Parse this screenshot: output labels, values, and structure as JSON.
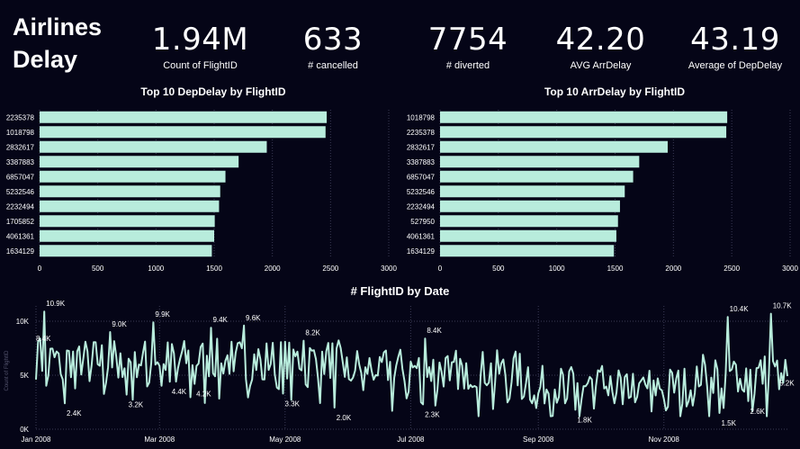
{
  "dashboard": {
    "title_line1": "Airlines",
    "title_line2": "Delay"
  },
  "kpis": [
    {
      "value": "1.94M",
      "label": "Count of FlightID"
    },
    {
      "value": "633",
      "label": "# cancelled"
    },
    {
      "value": "7754",
      "label": "# diverted"
    },
    {
      "value": "42.20",
      "label": "AVG ArrDelay"
    },
    {
      "value": "43.19",
      "label": "Average of DepDelay"
    }
  ],
  "colors": {
    "background": "#050517",
    "bar": "#b8ecdc",
    "line": "#b8ecdc",
    "grid": "#3a3a55"
  },
  "chart_data": [
    {
      "type": "bar",
      "orientation": "horizontal",
      "title": "Top 10 DepDelay by FlightID",
      "categories": [
        "2235378",
        "1018798",
        "2832617",
        "3387883",
        "6857047",
        "5232546",
        "2232494",
        "1705852",
        "4061361",
        "1634129"
      ],
      "values": [
        2467,
        2457,
        1952,
        1710,
        1597,
        1552,
        1542,
        1505,
        1500,
        1480
      ],
      "xlim": [
        0,
        3000
      ],
      "xticks": [
        "0",
        "500",
        "1000",
        "1500",
        "2000",
        "2500",
        "3000"
      ],
      "grid": true
    },
    {
      "type": "bar",
      "orientation": "horizontal",
      "title": "Top 10 ArrDelay by FlightID",
      "categories": [
        "1018798",
        "2235378",
        "2832617",
        "3387883",
        "6857047",
        "5232546",
        "2232494",
        "527950",
        "4061361",
        "1634129"
      ],
      "values": [
        2461,
        2453,
        1951,
        1707,
        1655,
        1583,
        1542,
        1525,
        1511,
        1490
      ],
      "xlim": [
        0,
        3000
      ],
      "xticks": [
        "0",
        "500",
        "1000",
        "1500",
        "2000",
        "2500",
        "3000"
      ],
      "grid": true
    },
    {
      "type": "line",
      "title": "# FlightID by Date",
      "ylabel": "Count of FlightID",
      "ylim": [
        0,
        11000
      ],
      "yticks": [
        "0K",
        "5K",
        "10K"
      ],
      "xticks": [
        "Jan 2008",
        "Mar 2008",
        "May 2008",
        "Jul 2008",
        "Sep 2008",
        "Nov 2008"
      ],
      "annotations": [
        "10.9K",
        "8.4K",
        "2.4K",
        "9.0K",
        "3.2K",
        "9.9K",
        "4.4K",
        "4.2K",
        "9.4K",
        "9.6K",
        "3.3K",
        "8.2K",
        "2.0K",
        "8.4K",
        "2.3K",
        "1.8K",
        "1.5K",
        "10.4K",
        "2.6K",
        "10.7K",
        "5.2K"
      ],
      "grid": true
    }
  ]
}
